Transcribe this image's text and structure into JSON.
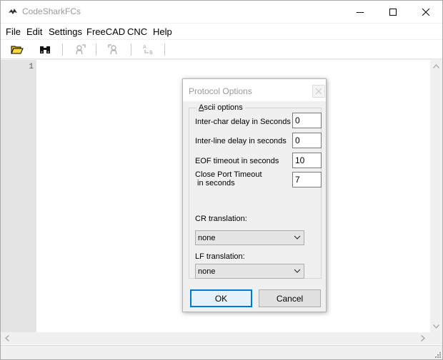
{
  "window": {
    "title": "CodeSharkFCs"
  },
  "menu": [
    "File",
    "Edit",
    "Settings",
    "FreeCAD",
    "CNC",
    "Help"
  ],
  "toolbar": {
    "icons": [
      "open-folder-icon",
      "binoculars-icon",
      "transmit-icon",
      "receive-icon",
      "convert-ab-icon"
    ]
  },
  "editor": {
    "line_numbers": [
      "1"
    ]
  },
  "dialog": {
    "title": "Protocol Options",
    "group_label_underlined": "A",
    "group_label_rest": "scii options",
    "fields": [
      {
        "label": "Inter-char delay in Seconds",
        "value": "0"
      },
      {
        "label": "Inter-line delay in seconds",
        "value": "0"
      },
      {
        "label": "EOF timeout in seconds",
        "value": "10"
      },
      {
        "label": "Close Port Timeout\n in seconds",
        "value": "7"
      }
    ],
    "cr": {
      "label": "CR translation:",
      "value": "none"
    },
    "lf": {
      "label": "LF translation:",
      "value": "none"
    },
    "ok_label": "OK",
    "cancel_label": "Cancel"
  },
  "colors": {
    "accent": "#0078d7",
    "gutter": "#e4e4e4",
    "chrome": "#f0f0f0"
  }
}
